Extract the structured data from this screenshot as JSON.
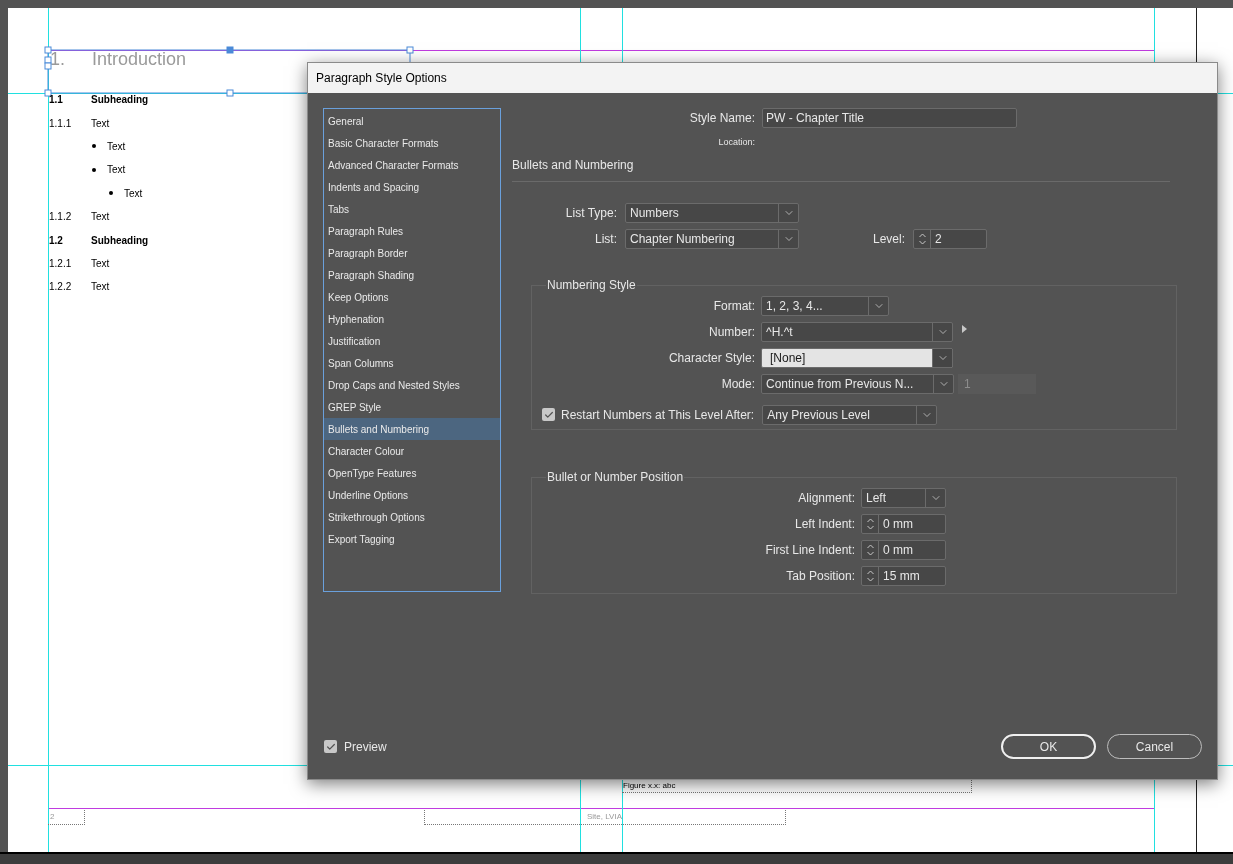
{
  "document": {
    "heading": {
      "number": "1.",
      "title": "Introduction"
    },
    "items": [
      {
        "kind": "numbered",
        "number": "1.1",
        "text": "Subheading",
        "bold": true
      },
      {
        "kind": "numbered",
        "number": "1.1.1",
        "text": "Text",
        "bold": false,
        "children": [
          {
            "kind": "bullet",
            "text": "Text"
          },
          {
            "kind": "bullet",
            "text": "Text",
            "children": [
              {
                "kind": "bullet",
                "text": "Text"
              }
            ]
          }
        ]
      },
      {
        "kind": "numbered",
        "number": "1.1.2",
        "text": "Text",
        "bold": false
      },
      {
        "kind": "numbered",
        "number": "1.2",
        "text": "Subheading",
        "bold": true
      },
      {
        "kind": "numbered",
        "number": "1.2.1",
        "text": "Text",
        "bold": false
      },
      {
        "kind": "numbered",
        "number": "1.2.2",
        "text": "Text",
        "bold": false
      }
    ],
    "figure_caption": "Figure x.x: abc",
    "page_number": "2",
    "footer_text": "Site, LVIA"
  },
  "dialog": {
    "title": "Paragraph Style Options",
    "categories": [
      {
        "label": "General",
        "selected": false
      },
      {
        "label": "Basic Character Formats",
        "selected": false
      },
      {
        "label": "Advanced Character Formats",
        "selected": false
      },
      {
        "label": "Indents and Spacing",
        "selected": false
      },
      {
        "label": "Tabs",
        "selected": false
      },
      {
        "label": "Paragraph Rules",
        "selected": false
      },
      {
        "label": "Paragraph Border",
        "selected": false
      },
      {
        "label": "Paragraph Shading",
        "selected": false
      },
      {
        "label": "Keep Options",
        "selected": false
      },
      {
        "label": "Hyphenation",
        "selected": false
      },
      {
        "label": "Justification",
        "selected": false
      },
      {
        "label": "Span Columns",
        "selected": false
      },
      {
        "label": "Drop Caps and Nested Styles",
        "selected": false
      },
      {
        "label": "GREP Style",
        "selected": false
      },
      {
        "label": "Bullets and Numbering",
        "selected": true
      },
      {
        "label": "Character Colour",
        "selected": false
      },
      {
        "label": "OpenType Features",
        "selected": false
      },
      {
        "label": "Underline Options",
        "selected": false
      },
      {
        "label": "Strikethrough Options",
        "selected": false
      },
      {
        "label": "Export Tagging",
        "selected": false
      }
    ],
    "style_name": {
      "label": "Style Name:",
      "value": "PW - Chapter Title"
    },
    "location_label": "Location:",
    "section_title": "Bullets and Numbering",
    "list_type": {
      "label": "List Type:",
      "value": "Numbers"
    },
    "list": {
      "label": "List:",
      "value": "Chapter Numbering"
    },
    "level": {
      "label": "Level:",
      "value": "2"
    },
    "numbering_style": {
      "title": "Numbering Style",
      "format": {
        "label": "Format:",
        "value": "1, 2, 3, 4..."
      },
      "number": {
        "label": "Number:",
        "value": "^H.^t"
      },
      "character_style": {
        "label": "Character Style:",
        "value": "[None]",
        "focused": true
      },
      "mode": {
        "label": "Mode:",
        "value": "Continue from Previous N...",
        "start_value": "1"
      },
      "restart": {
        "label": "Restart Numbers at This Level After:",
        "checked": true,
        "value": "Any Previous Level"
      }
    },
    "position": {
      "title": "Bullet or Number Position",
      "alignment": {
        "label": "Alignment:",
        "value": "Left"
      },
      "left_indent": {
        "label": "Left Indent:",
        "value": "0 mm"
      },
      "first_line_indent": {
        "label": "First Line Indent:",
        "value": "0 mm"
      },
      "tab_position": {
        "label": "Tab Position:",
        "value": "15 mm"
      }
    },
    "preview": {
      "label": "Preview",
      "checked": true
    },
    "buttons": [
      {
        "label": "OK",
        "kind": "primary"
      },
      {
        "label": "Cancel",
        "kind": "secondary"
      }
    ]
  }
}
